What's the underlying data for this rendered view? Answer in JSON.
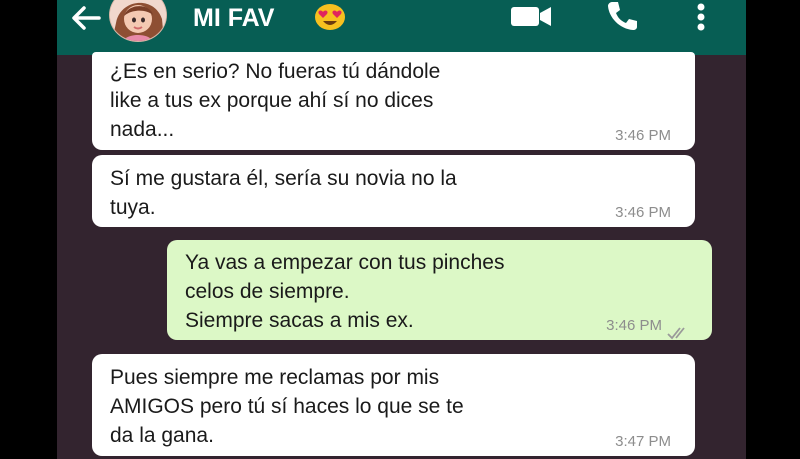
{
  "header": {
    "back_icon": "arrow-left-icon",
    "contact_name": "MI FAV",
    "title_emoji": "heart-eyes-emoji",
    "video_icon": "video-call-icon",
    "call_icon": "phone-icon",
    "menu_icon": "more-vert-icon",
    "header_color": "#075e54"
  },
  "chat": {
    "background_color": "#33242f",
    "incoming_bubble_color": "#ffffff",
    "outgoing_bubble_color": "#dcf8c6",
    "messages": [
      {
        "direction": "incoming",
        "text": "¿Es en serio? No fueras tú dándole\nlike a tus ex porque ahí sí no dices\nnada...",
        "time": "3:46 PM"
      },
      {
        "direction": "incoming",
        "text": "Sí me gustara él, sería su novia no la\ntuya.",
        "time": "3:46 PM"
      },
      {
        "direction": "outgoing",
        "text": "Ya vas a empezar con tus pinches\ncelos de siempre.\nSiempre sacas a mis ex.",
        "time": "3:46 PM",
        "status": "read"
      },
      {
        "direction": "incoming",
        "text": "Pues siempre me reclamas por mis\nAMIGOS pero tú sí haces lo que se te\nda la gana.",
        "time": "3:47 PM"
      }
    ]
  }
}
